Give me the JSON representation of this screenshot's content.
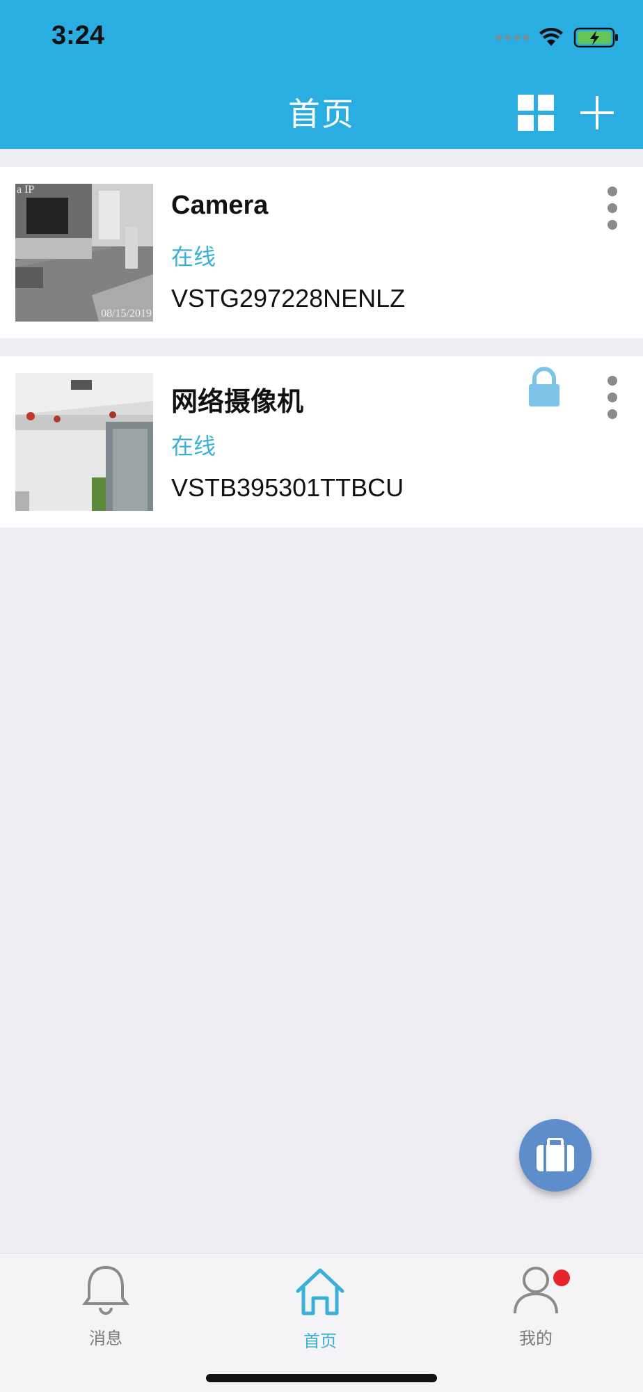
{
  "status_bar": {
    "time": "3:24"
  },
  "header": {
    "title": "首页",
    "grid_icon": "grid-view-icon",
    "add_icon": "plus-icon"
  },
  "devices": [
    {
      "name": "Camera",
      "status": "在线",
      "id": "VSTG297228NENLZ",
      "thumb_tag": "a IP",
      "thumb_timestamp": "08/15/2019",
      "locked": false
    },
    {
      "name": "网络摄像机",
      "status": "在线",
      "id": "VSTB395301TTBCU",
      "locked": true
    }
  ],
  "fab": {
    "icon": "briefcase-icon"
  },
  "tabbar": {
    "tabs": [
      {
        "label": "消息",
        "icon": "bell-icon",
        "active": false
      },
      {
        "label": "首页",
        "icon": "home-icon",
        "active": true
      },
      {
        "label": "我的",
        "icon": "user-icon",
        "active": false,
        "badge": true
      }
    ]
  },
  "colors": {
    "primary": "#2AADE1",
    "status_online": "#3AAFD9",
    "fab": "#5E8DCB",
    "badge": "#E5252A"
  }
}
